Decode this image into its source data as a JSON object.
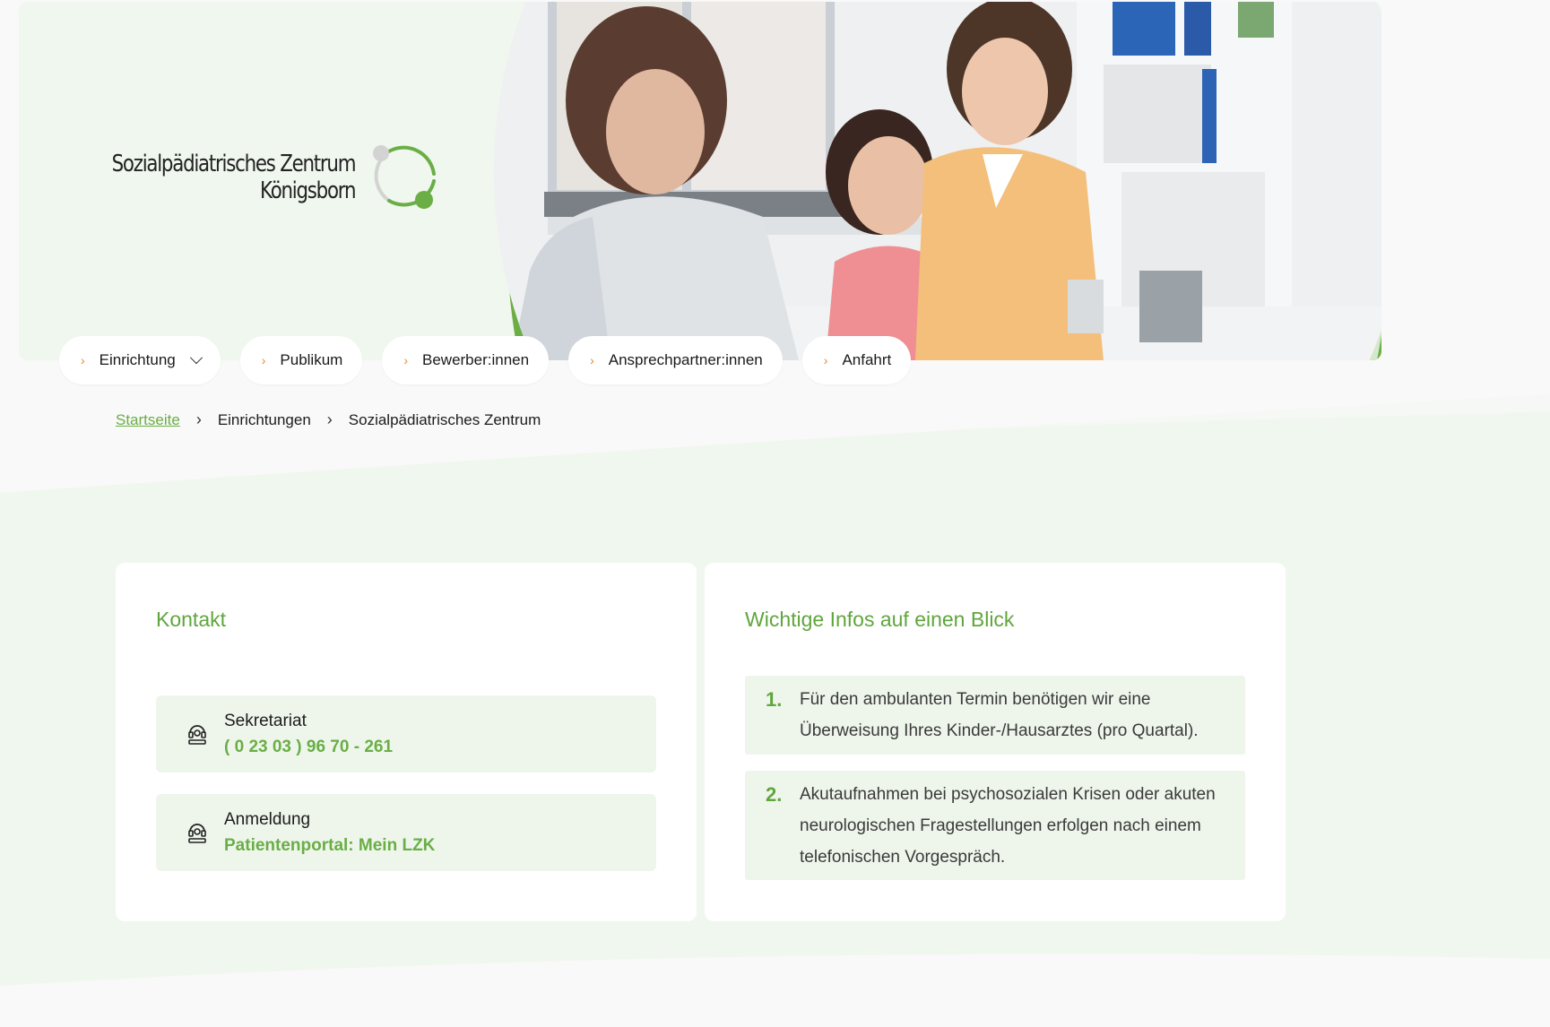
{
  "logo": {
    "line1": "Sozialpädiatrisches Zentrum",
    "line2": "Königsborn"
  },
  "colors": {
    "accent": "#6aae45",
    "panel_bg": "#f0f7ee",
    "box_bg": "#eef6ec",
    "chevron": "#e08a30"
  },
  "nav": {
    "items": [
      {
        "label": "Einrichtung",
        "has_dropdown": true
      },
      {
        "label": "Publikum"
      },
      {
        "label": "Bewerber:innen"
      },
      {
        "label": "Ansprechpartner:innen"
      },
      {
        "label": "Anfahrt"
      }
    ]
  },
  "breadcrumb": {
    "home": "Startseite",
    "level1": "Einrichtungen",
    "current": "Sozialpädiatrisches Zentrum"
  },
  "kontakt": {
    "title": "Kontakt",
    "entries": [
      {
        "label": "Sekretariat",
        "value": "( 0 23 03 ) 96 70 - 261",
        "icon": "phone-icon"
      },
      {
        "label": "Anmeldung",
        "value": "Patientenportal: Mein LZK",
        "icon": "phone-icon"
      }
    ]
  },
  "infos": {
    "title": "Wichtige Infos auf einen Blick",
    "items": [
      {
        "num": "1.",
        "text": "Für den ambulanten Termin benötigen wir eine Überweisung Ihres Kinder-/Hausarztes (pro Quartal)."
      },
      {
        "num": "2.",
        "text": "Akutaufnahmen bei psychosozialen Krisen oder akuten neurologischen Fragestellungen erfolgen nach einem telefonischen Vorgespräch."
      }
    ]
  }
}
